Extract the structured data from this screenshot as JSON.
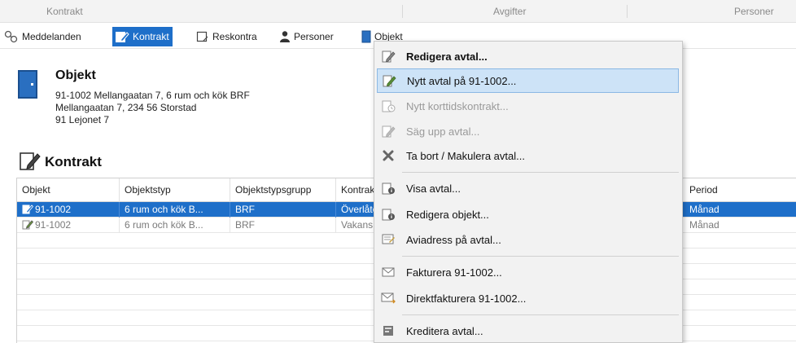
{
  "group_header": {
    "kontrakt": "Kontrakt",
    "avgifter": "Avgifter",
    "personer": "Personer"
  },
  "tabs": [
    {
      "label": "Meddelanden",
      "icon": "people-link-icon"
    },
    {
      "label": "Kontrakt",
      "icon": "contract-edit-icon",
      "active": true
    },
    {
      "label": "Reskontra",
      "icon": "ledger-icon"
    },
    {
      "label": "Personer",
      "icon": "person-icon"
    },
    {
      "label": "Objekt",
      "icon": "object-icon"
    }
  ],
  "objekt": {
    "title": "Objekt",
    "line1": "91-1002 Mellangaatan 7,  6 rum och kök BRF",
    "line2": "Mellangaatan 7, 234 56 Storstad",
    "line3": "91 Lejonet 7"
  },
  "section_title": "Kontrakt",
  "grid": {
    "columns": [
      "Objekt",
      "Objektstyp",
      "Objektstypsgrupp",
      "Kontrak",
      "Period"
    ],
    "rows": [
      {
        "objekt": "91-1002",
        "objektstyp": "6 rum och kök B...",
        "grupp": "BRF",
        "kontrakt": "Överlåte",
        "period": "Månad",
        "selected": true
      },
      {
        "objekt": "91-1002",
        "objektstyp": "6 rum och kök B...",
        "grupp": "BRF",
        "kontrakt": "Vakans",
        "period": "Månad",
        "selected": false
      }
    ]
  },
  "context_menu": {
    "items": [
      {
        "label": "Redigera avtal...",
        "icon": "edit-contract-icon",
        "bold": true
      },
      {
        "label": "Nytt avtal på 91-1002...",
        "icon": "new-contract-icon",
        "highlighted": true
      },
      {
        "label": "Nytt korttidskontrakt...",
        "icon": "short-term-contract-icon",
        "disabled": true
      },
      {
        "label": "Säg upp avtal...",
        "icon": "terminate-contract-icon",
        "disabled": true
      },
      {
        "label": "Ta bort / Makulera avtal...",
        "icon": "delete-icon"
      },
      {
        "label": "Visa avtal...",
        "icon": "view-contract-icon"
      },
      {
        "label": "Redigera objekt...",
        "icon": "edit-object-icon"
      },
      {
        "label": "Aviadress på avtal...",
        "icon": "address-icon"
      },
      {
        "label": "Fakturera 91-1002...",
        "icon": "envelope-icon"
      },
      {
        "label": "Direktfakturera 91-1002...",
        "icon": "envelope-arrow-icon"
      },
      {
        "label": "Kreditera avtal...",
        "icon": "credit-icon"
      }
    ]
  },
  "colors": {
    "accent": "#1e6fc9",
    "menu_highlight": "#cde3f7"
  }
}
